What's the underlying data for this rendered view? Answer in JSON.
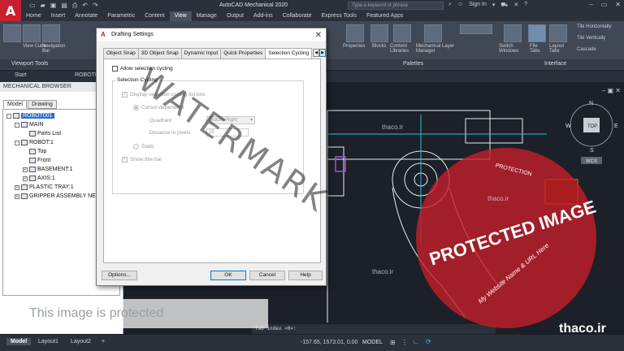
{
  "app": {
    "logo_letter": "A",
    "title": "AutoCAD Mechanical 2020",
    "search_placeholder": "Type a keyword or phrase",
    "sign_in": "Sign In"
  },
  "ribbon_tabs": [
    "Home",
    "Insert",
    "Annotate",
    "Parametric",
    "Content",
    "View",
    "Manage",
    "Output",
    "Add-ins",
    "Collaborate",
    "Express Tools",
    "Featured Apps"
  ],
  "ribbon": {
    "panels": [
      "Viewport Tools",
      "Palettes",
      "Interface"
    ],
    "labels": {
      "view_cube": "View Cube",
      "navigation_bar": "Navigation Bar",
      "properties": "Properties",
      "blocks": "Blocks",
      "content_libraries": "Content Libraries",
      "mechanical_layer_manager": "Mechanical Layer Manager",
      "switch_windows": "Switch Windows",
      "file_tabs": "File Tabs",
      "layout_tabs": "Layout Tabs",
      "tile_horizontally": "Tile Horizontally",
      "tile_vertically": "Tile Vertically",
      "cascade": "Cascade"
    }
  },
  "doc_tabs": {
    "start": "Start",
    "current": "ROBOT0"
  },
  "browser": {
    "title": "MECHANICAL BROWSER",
    "tabs": [
      "Model",
      "Drawing"
    ],
    "tree": [
      {
        "label": "ROBOT001",
        "level": 0,
        "expander": "-",
        "selected": true
      },
      {
        "label": "MAIN",
        "level": 1,
        "expander": "-",
        "selected": false
      },
      {
        "label": "Parts List",
        "level": 2,
        "expander": "",
        "selected": false
      },
      {
        "label": "ROBOT:1",
        "level": 1,
        "expander": "-",
        "selected": false
      },
      {
        "label": "Top",
        "level": 2,
        "expander": "",
        "selected": false
      },
      {
        "label": "Front",
        "level": 2,
        "expander": "",
        "selected": false
      },
      {
        "label": "BASEMENT:1",
        "level": 2,
        "expander": "+",
        "selected": false
      },
      {
        "label": "AXIS:1",
        "level": 2,
        "expander": "+",
        "selected": false
      },
      {
        "label": "PLASTIC TRAY:1",
        "level": 1,
        "expander": "+",
        "selected": false
      },
      {
        "label": "GRIPPER ASSEMBLY NEW",
        "level": 1,
        "expander": "+",
        "selected": false
      }
    ]
  },
  "dialog": {
    "title": "Drafting Settings",
    "tabs": [
      "Object Snap",
      "3D Object Snap",
      "Dynamic Input",
      "Quick Properties",
      "Selection Cycling"
    ],
    "active_tab": "Selection Cycling",
    "allow_selection_cycling": {
      "label": "Allow selection cycling",
      "checked": false
    },
    "group_title": "Selection Cycling",
    "display_list_box": {
      "label": "Display selection cycling list box",
      "checked": true
    },
    "cursor_dependent": {
      "label": "Cursor-dependent",
      "selected": true
    },
    "quadrant": {
      "label": "Quadrant",
      "value": "Bottom-Right"
    },
    "distance": {
      "label": "Distance in pixels",
      "value": "25"
    },
    "static": {
      "label": "Static",
      "selected": false
    },
    "show_title_bar": {
      "label": "Show title bar",
      "checked": true
    },
    "buttons": {
      "options": "Options...",
      "ok": "OK",
      "cancel": "Cancel",
      "help": "Help"
    }
  },
  "viewcube": {
    "top": "TOP",
    "n": "N",
    "e": "E",
    "s": "S",
    "w": "W",
    "wcs": "WCS"
  },
  "command_line": "Tab index <0>:",
  "status": {
    "tabs": [
      "Model",
      "Layout1",
      "Layout2"
    ],
    "coords": "-157.65, 1573.01, 0.00",
    "mode": "MODEL"
  },
  "overlays": {
    "watermark": "WATERMARK",
    "protected_text": "This image is protected",
    "stamp_main": "PROTECTED IMAGE",
    "stamp_sub": "My Website Name & URL Here",
    "stamp_top": "PROTECTION",
    "thaco": "thaco.ir",
    "brand": "thaco.ir"
  },
  "colors": {
    "autocad_red": "#c8202f",
    "dark_bg": "#1b2029",
    "accent_cyan": "#25c4d8"
  }
}
